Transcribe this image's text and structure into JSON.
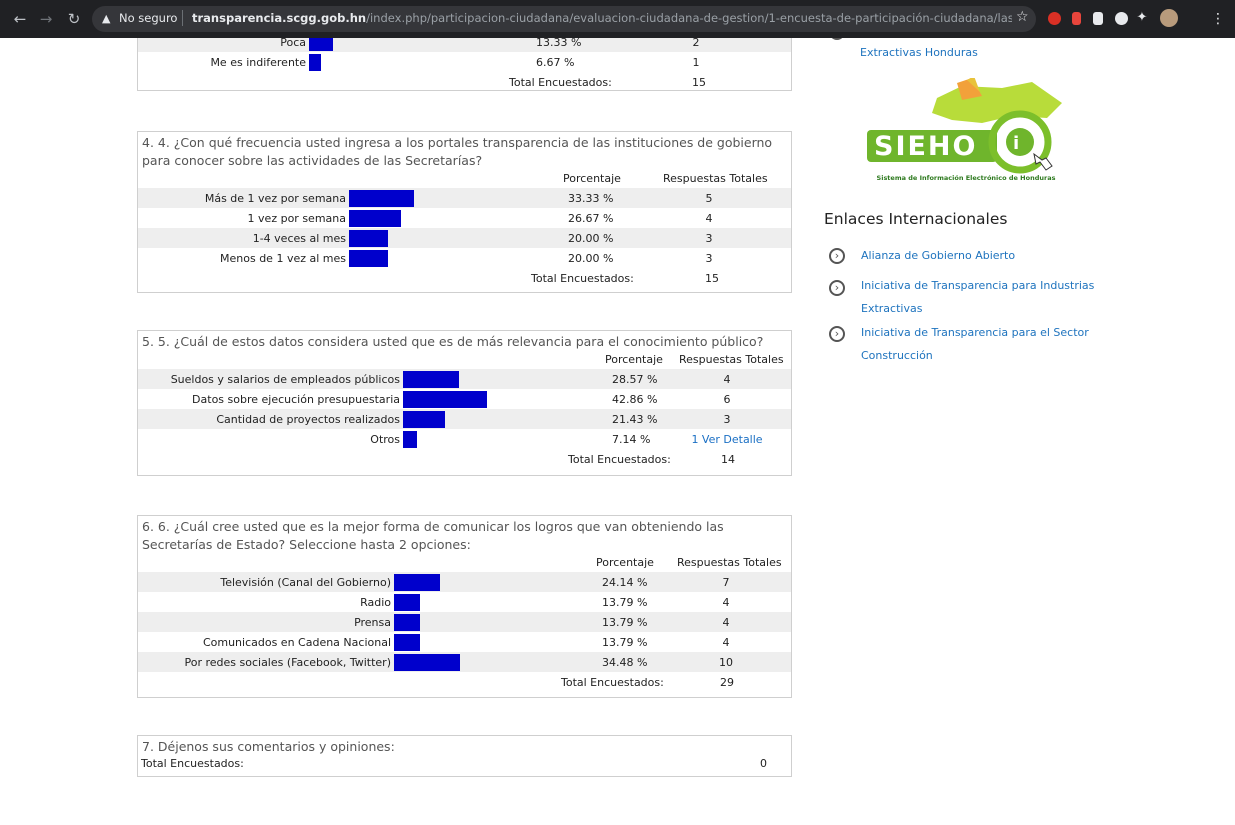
{
  "browser": {
    "security": "No seguro",
    "url_host": "transparencia.scgg.gob.hn",
    "url_path": "/index.php/participacion-ciudadana/evaluacion-ciudadana-de-gestion/1-encuesta-de-participación-ciudadana/last/edi..."
  },
  "q3": {
    "rows": [
      {
        "label": "Poca",
        "pct": "13.33 %",
        "count": "2",
        "fraction": 0.1333
      },
      {
        "label": "Me es indiferente",
        "pct": "6.67 %",
        "count": "1",
        "fraction": 0.0667
      }
    ],
    "total_label": "Total Encuestados:",
    "total": "15"
  },
  "q4": {
    "title": "4. 4. ¿Con qué frecuencia usted ingresa a los portales transparencia de las instituciones de gobierno para conocer sobre las actividades de las Secretarías?",
    "col_pct": "Porcentaje",
    "col_count": "Respuestas Totales",
    "rows": [
      {
        "label": "Más de 1 vez por semana",
        "pct": "33.33 %",
        "count": "5",
        "fraction": 0.3333
      },
      {
        "label": "1 vez por semana",
        "pct": "26.67 %",
        "count": "4",
        "fraction": 0.2667
      },
      {
        "label": "1-4 veces al mes",
        "pct": "20.00 %",
        "count": "3",
        "fraction": 0.2
      },
      {
        "label": "Menos de 1 vez al mes",
        "pct": "20.00 %",
        "count": "3",
        "fraction": 0.2
      }
    ],
    "total_label": "Total Encuestados:",
    "total": "15"
  },
  "q5": {
    "title": "5. 5. ¿Cuál de estos datos considera usted que es de más relevancia para el conocimiento público?",
    "col_pct": "Porcentaje",
    "col_count": "Respuestas Totales",
    "rows": [
      {
        "label": "Sueldos y salarios de empleados públicos",
        "pct": "28.57 %",
        "count": "4",
        "fraction": 0.2857
      },
      {
        "label": "Datos sobre ejecución presupuestaria",
        "pct": "42.86 %",
        "count": "6",
        "fraction": 0.4286
      },
      {
        "label": "Cantidad de proyectos realizados",
        "pct": "21.43 %",
        "count": "3",
        "fraction": 0.2143
      },
      {
        "label": "Otros",
        "pct": "7.14 %",
        "count": "1 Ver Detalle",
        "fraction": 0.0714
      }
    ],
    "total_label": "Total Encuestados:",
    "total": "14"
  },
  "q6": {
    "title": "6. 6. ¿Cuál cree usted que es la mejor forma de comunicar los logros que van obteniendo las Secretarías de Estado? Seleccione hasta 2 opciones:",
    "col_pct": "Porcentaje",
    "col_count": "Respuestas Totales",
    "rows": [
      {
        "label": "Televisión (Canal del Gobierno)",
        "pct": "24.14 %",
        "count": "7",
        "fraction": 0.2414
      },
      {
        "label": "Radio",
        "pct": "13.79 %",
        "count": "4",
        "fraction": 0.1379
      },
      {
        "label": "Prensa",
        "pct": "13.79 %",
        "count": "4",
        "fraction": 0.1379
      },
      {
        "label": "Comunicados en Cadena Nacional",
        "pct": "13.79 %",
        "count": "4",
        "fraction": 0.1379
      },
      {
        "label": "Por redes sociales (Facebook, Twitter)",
        "pct": "34.48 %",
        "count": "10",
        "fraction": 0.3448
      }
    ],
    "total_label": "Total Encuestados:",
    "total": "29"
  },
  "q7": {
    "title": "7. Déjenos sus comentarios y opiniones:",
    "total_label": "Total Encuestados:",
    "total": "0"
  },
  "sidebar": {
    "top_link": "Extractivas Honduras",
    "logo_text": "SIEHO",
    "logo_caption": "Sistema de Información Electrónico de Honduras",
    "section_title": "Enlaces Internacionales",
    "links": [
      {
        "line1": "Alianza de Gobierno Abierto",
        "line2": ""
      },
      {
        "line1": "Iniciativa de Transparencia para Industrias",
        "line2": "Extractivas"
      },
      {
        "line1": "Iniciativa de Transparencia para el Sector",
        "line2": "Construcción"
      }
    ]
  },
  "colors": {
    "bar": "#0000cc",
    "link": "#1e73be",
    "logo_green": "#7cbf2b"
  }
}
